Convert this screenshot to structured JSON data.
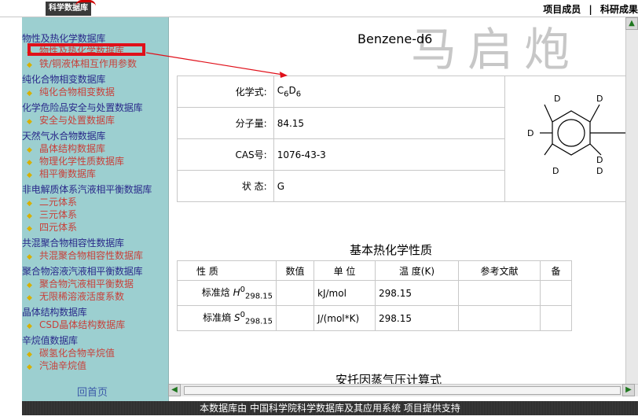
{
  "topbar": {
    "logo_text": "科学数据库",
    "nav": [
      "项目成员",
      "科研成果"
    ],
    "separator": "|"
  },
  "sidebar": {
    "groups": [
      {
        "title": "物性及热化学数据库",
        "items": [
          "物性及热化学数据库",
          "铁/铜液体相互作用参数"
        ]
      },
      {
        "title": "纯化合物相变数据库",
        "items": [
          "纯化合物相变数据"
        ]
      },
      {
        "title": "化学危险品安全与处置数据库",
        "items": [
          "安全与处置数据库"
        ]
      },
      {
        "title": "天然气水合物数据库",
        "items": [
          "晶体结构数据库",
          "物理化学性质数据库",
          "相平衡数据库"
        ]
      },
      {
        "title": "非电解质体系汽液相平衡数据库",
        "items": [
          "二元体系",
          "三元体系",
          "四元体系"
        ]
      },
      {
        "title": "共混聚合物相容性数据库",
        "items": [
          "共混聚合物相容性数据库"
        ]
      },
      {
        "title": "聚合物溶液汽液相平衡数据库",
        "items": [
          "聚合物汽液相平衡数据",
          "无限稀溶液活度系数"
        ]
      },
      {
        "title": "晶体结构数据库",
        "items": [
          "CSD晶体结构数据库"
        ]
      },
      {
        "title": "辛烷值数据库",
        "items": [
          "碳氢化合物辛烷值",
          "汽油辛烷值"
        ]
      }
    ],
    "home_link": "回首页",
    "accent_color": "#9ccfd0",
    "link_color": "#c8403a"
  },
  "main": {
    "compound_title": "Benzene-d6",
    "watermark": "马启炮",
    "properties": [
      {
        "label": "化学式:",
        "value_html": "C<sub>6</sub>D<sub>6</sub>"
      },
      {
        "label": "分子量:",
        "value": "84.15"
      },
      {
        "label": "CAS号:",
        "value": "1076-43-3"
      },
      {
        "label": "状  态:",
        "value": "G"
      }
    ],
    "structure_atom": "D",
    "thermo_title": "基本热化学性质",
    "thermo_headers": [
      "性 质",
      "数值",
      "单 位",
      "温 度(K)",
      "参考文献",
      "备"
    ],
    "thermo_rows": [
      {
        "property": "标准焓",
        "symbol": "H",
        "sup": "0",
        "sub": "298.15",
        "value": "",
        "unit": "kJ/mol",
        "temp": "298.15",
        "ref": ""
      },
      {
        "property": "标准熵",
        "symbol": "S",
        "sup": "0",
        "sub": "298.15",
        "value": "",
        "unit": "J/(mol*K)",
        "temp": "298.15",
        "ref": ""
      }
    ],
    "antoine_title": "安托因蒸气压计算式"
  },
  "footer": {
    "text": "本数据库由 中国科学院科学数据库及其应用系统 项目提供支持"
  }
}
